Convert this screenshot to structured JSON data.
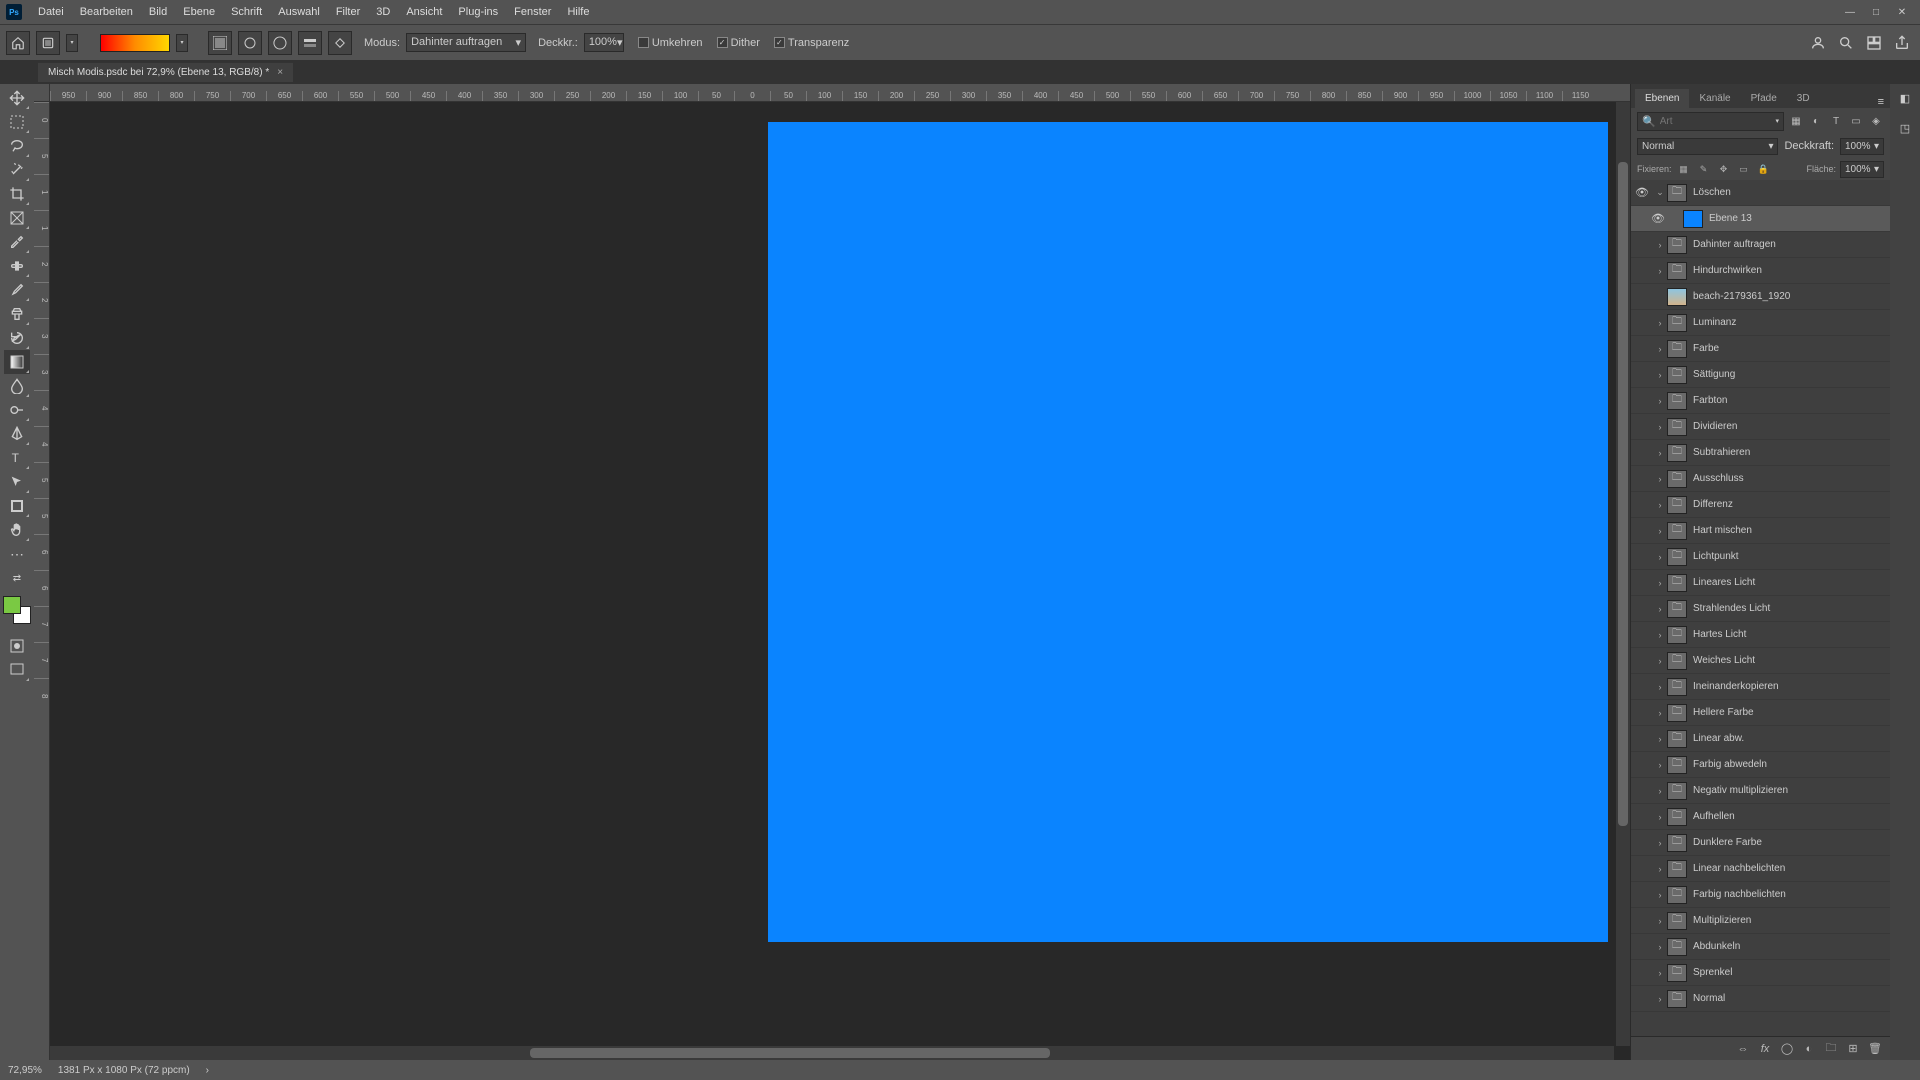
{
  "menu": [
    "Datei",
    "Bearbeiten",
    "Bild",
    "Ebene",
    "Schrift",
    "Auswahl",
    "Filter",
    "3D",
    "Ansicht",
    "Plug-ins",
    "Fenster",
    "Hilfe"
  ],
  "options": {
    "modus_label": "Modus:",
    "modus_value": "Dahinter auftragen",
    "deckkr_label": "Deckkr.:",
    "deckkr_value": "100%",
    "umkehren": "Umkehren",
    "dither": "Dither",
    "transparenz": "Transparenz"
  },
  "doc": {
    "tab": "Misch Modis.psdc bei 72,9% (Ebene 13, RGB/8) *"
  },
  "ruler_ticks": [
    "950",
    "900",
    "850",
    "800",
    "750",
    "700",
    "650",
    "600",
    "550",
    "500",
    "450",
    "400",
    "350",
    "300",
    "250",
    "200",
    "150",
    "100",
    "50",
    "0",
    "50",
    "100",
    "150",
    "200",
    "250",
    "300",
    "350",
    "400",
    "450",
    "500",
    "550",
    "600",
    "650",
    "700",
    "750",
    "800",
    "850",
    "900",
    "950",
    "1000",
    "1050",
    "1100",
    "1150"
  ],
  "ruler_v": [
    "0",
    "5",
    "1",
    "1",
    "2",
    "2",
    "3",
    "3",
    "4",
    "4",
    "5",
    "5",
    "6",
    "6",
    "7",
    "7",
    "8"
  ],
  "panels": {
    "tabs": [
      "Ebenen",
      "Kanäle",
      "Pfade",
      "3D"
    ],
    "search_placeholder": "Art",
    "blend": "Normal",
    "deckkraft_label": "Deckkraft:",
    "deckkraft_value": "100%",
    "fix_label": "Fixieren:",
    "flaeche_label": "Fläche:",
    "flaeche_value": "100%"
  },
  "layers": [
    {
      "type": "group-open",
      "name": "Löschen",
      "vis": true
    },
    {
      "type": "layer",
      "name": "Ebene 13",
      "vis": true,
      "thumb": "blue",
      "selected": true,
      "indent": 1
    },
    {
      "type": "group",
      "name": "Dahinter auftragen"
    },
    {
      "type": "group",
      "name": "Hindurchwirken"
    },
    {
      "type": "img",
      "name": "beach-2179361_1920",
      "thumb": "img"
    },
    {
      "type": "group",
      "name": "Luminanz"
    },
    {
      "type": "group",
      "name": "Farbe"
    },
    {
      "type": "group",
      "name": "Sättigung"
    },
    {
      "type": "group",
      "name": "Farbton"
    },
    {
      "type": "group",
      "name": "Dividieren"
    },
    {
      "type": "group",
      "name": "Subtrahieren"
    },
    {
      "type": "group",
      "name": "Ausschluss"
    },
    {
      "type": "group",
      "name": "Differenz"
    },
    {
      "type": "group",
      "name": "Hart mischen"
    },
    {
      "type": "group",
      "name": "Lichtpunkt"
    },
    {
      "type": "group",
      "name": "Lineares Licht"
    },
    {
      "type": "group",
      "name": "Strahlendes Licht"
    },
    {
      "type": "group",
      "name": "Hartes Licht"
    },
    {
      "type": "group",
      "name": "Weiches Licht"
    },
    {
      "type": "group",
      "name": "Ineinanderkopieren"
    },
    {
      "type": "group",
      "name": "Hellere Farbe"
    },
    {
      "type": "group",
      "name": "Linear abw."
    },
    {
      "type": "group",
      "name": "Farbig abwedeln"
    },
    {
      "type": "group",
      "name": "Negativ multiplizieren"
    },
    {
      "type": "group",
      "name": "Aufhellen"
    },
    {
      "type": "group",
      "name": "Dunklere Farbe"
    },
    {
      "type": "group",
      "name": "Linear nachbelichten"
    },
    {
      "type": "group",
      "name": "Farbig nachbelichten"
    },
    {
      "type": "group",
      "name": "Multiplizieren"
    },
    {
      "type": "group",
      "name": "Abdunkeln"
    },
    {
      "type": "group",
      "name": "Sprenkel"
    },
    {
      "type": "group",
      "name": "Normal"
    }
  ],
  "status": {
    "zoom": "72,95%",
    "docinfo": "1381 Px x 1080 Px (72 ppcm)"
  }
}
